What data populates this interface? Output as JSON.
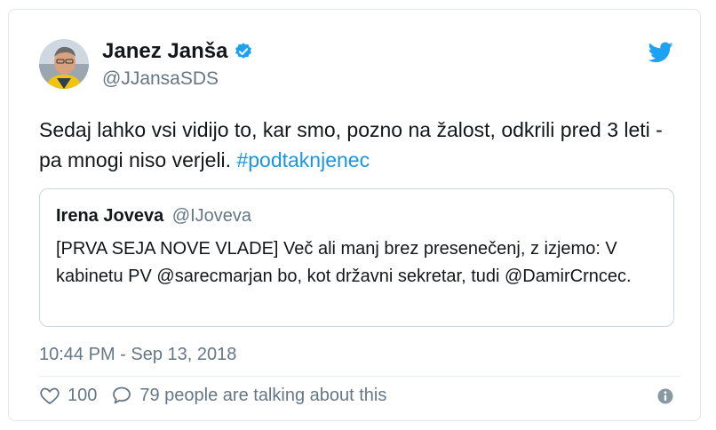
{
  "author": {
    "name": "Janez Janša",
    "handle": "@JJansaSDS"
  },
  "tweet": {
    "text": "Sedaj lahko vsi vidijo to, kar smo, pozno na žalost, odkrili pred 3 leti - pa mnogi niso verjeli.",
    "hashtag": "#podtaknjenec",
    "timestamp": "10:44 PM - Sep 13, 2018"
  },
  "quoted": {
    "name": "Irena Joveva",
    "handle": "@IJoveva",
    "text": "[PRVA SEJA NOVE VLADE] Več ali manj brez presenečenj, z izjemo: V kabinetu PV @sarecmarjan bo, kot državni sekretar, tudi @DamirCrncec."
  },
  "stats": {
    "likes": "100",
    "replies": "79 people are talking about this"
  },
  "icons": {
    "verified": "verified-badge-icon",
    "logo": "twitter-bird-icon",
    "like": "heart-icon",
    "reply": "speech-bubble-icon",
    "info": "info-icon"
  },
  "colors": {
    "accent": "#1da1f2",
    "hashtag": "#1b95e0",
    "muted": "#657786"
  }
}
